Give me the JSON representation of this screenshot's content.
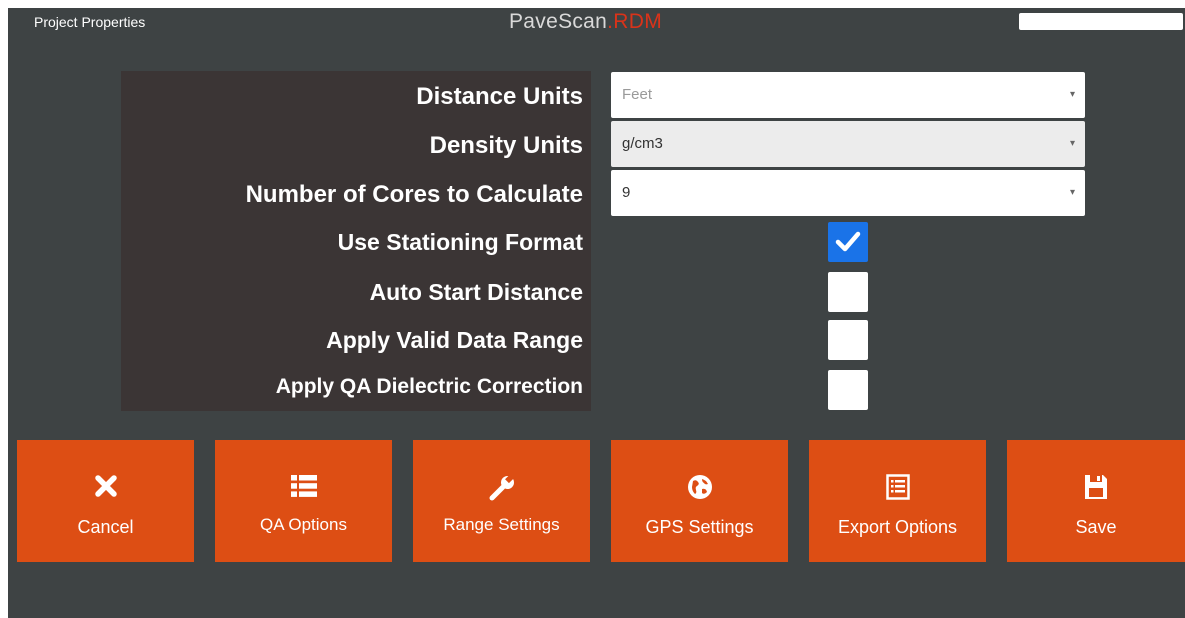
{
  "window": {
    "title": "Project Properties",
    "logo_main": "PaveScan",
    "logo_dot": ".",
    "logo_suffix": "RDM"
  },
  "settings": {
    "distance_units": {
      "label": "Distance Units",
      "value": "Feet"
    },
    "density_units": {
      "label": "Density Units",
      "value": "g/cm3"
    },
    "num_cores": {
      "label": "Number of Cores to Calculate",
      "value": "9"
    },
    "use_stationing": {
      "label": "Use Stationing Format",
      "checked": true
    },
    "auto_start": {
      "label": "Auto Start Distance",
      "checked": false
    },
    "valid_range": {
      "label": "Apply Valid Data Range",
      "checked": false
    },
    "qa_dielectric": {
      "label": "Apply QA Dielectric Correction",
      "checked": false
    }
  },
  "buttons": {
    "cancel": {
      "label": "Cancel",
      "icon": "close-icon"
    },
    "qa_options": {
      "label": "QA Options",
      "icon": "list-icon"
    },
    "range_settings": {
      "label": "Range Settings",
      "icon": "wrench-icon"
    },
    "gps_settings": {
      "label": "GPS Settings",
      "icon": "globe-icon"
    },
    "export_options": {
      "label": "Export Options",
      "icon": "document-list-icon"
    },
    "save": {
      "label": "Save",
      "icon": "floppy-disk-icon"
    }
  },
  "colors": {
    "background": "#3e4344",
    "panel": "#3b3535",
    "accent": "#dd4e14",
    "logo_accent": "#d9331a",
    "checkbox_checked": "#1a73e8"
  }
}
